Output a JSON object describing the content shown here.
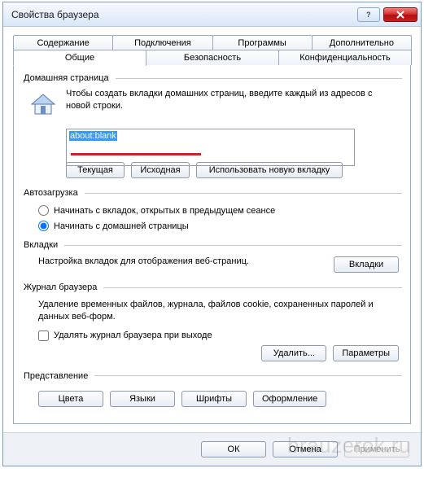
{
  "window": {
    "title": "Свойства браузера"
  },
  "tabs": {
    "row1": [
      "Содержание",
      "Подключения",
      "Программы",
      "Дополнительно"
    ],
    "row2": [
      "Общие",
      "Безопасность",
      "Конфиденциальность"
    ],
    "active": "Общие"
  },
  "home": {
    "group_label": "Домашняя страница",
    "instruction": "Чтобы создать вкладки домашних страниц, введите каждый из адресов с новой строки.",
    "value": "about:blank",
    "buttons": {
      "current": "Текущая",
      "default": "Исходная",
      "newtab": "Использовать новую вкладку"
    }
  },
  "startup": {
    "group_label": "Автозагрузка",
    "opt_tabs": "Начинать с вкладок, открытых в предыдущем сеансе",
    "opt_home": "Начинать с домашней страницы",
    "selected": "home"
  },
  "tabs_section": {
    "group_label": "Вкладки",
    "text": "Настройка вкладок для отображения веб-страниц.",
    "button": "Вкладки"
  },
  "history": {
    "group_label": "Журнал браузера",
    "text": "Удаление временных файлов, журнала, файлов cookie, сохраненных паролей и данных веб-форм.",
    "check_label": "Удалять журнал браузера при выходе",
    "checked": false,
    "buttons": {
      "delete": "Удалить...",
      "settings": "Параметры"
    }
  },
  "appearance": {
    "group_label": "Представление",
    "buttons": {
      "colors": "Цвета",
      "languages": "Языки",
      "fonts": "Шрифты",
      "accessibility": "Оформление"
    }
  },
  "footer": {
    "ok": "ОК",
    "cancel": "Отмена",
    "apply": "Применить"
  },
  "watermark": "brauzerok.ru"
}
